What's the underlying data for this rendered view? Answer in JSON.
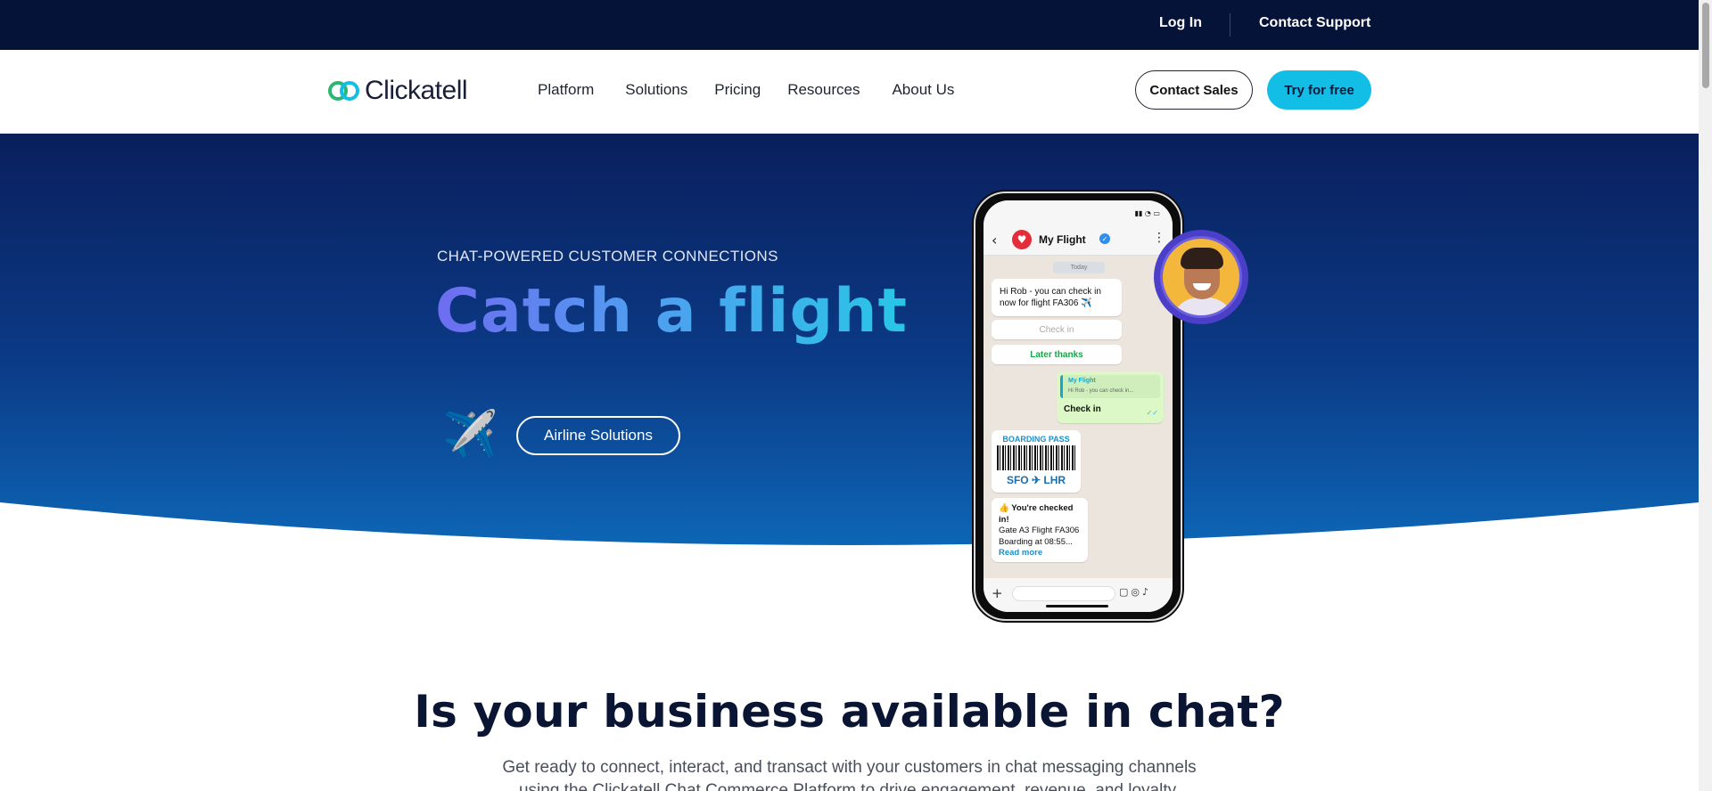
{
  "topbar": {
    "login": "Log In",
    "support": "Contact Support"
  },
  "brand": {
    "name": "Clickatell"
  },
  "nav": {
    "items": [
      "Platform",
      "Solutions",
      "Pricing",
      "Resources",
      "About Us"
    ],
    "contact_sales": "Contact Sales",
    "try_free": "Try for free"
  },
  "hero": {
    "eyebrow": "CHAT-POWERED CUSTOMER CONNECTIONS",
    "headline": "Catch a flight",
    "plane_emoji": "✈️",
    "cta": "Airline Solutions"
  },
  "phone": {
    "chat_name": "My Flight",
    "day": "Today",
    "message1": "Hi Rob - you can check in now for flight FA306 ✈️",
    "quick_reply1": "Check in",
    "quick_reply2": "Later thanks",
    "reply_quote_title": "My Flight",
    "reply_quote_text": "Hi Rob - you can check in...",
    "reply_text": "Check in",
    "boarding_title": "BOARDING PASS",
    "boarding_route": "SFO ✈ LHR",
    "checked_line1": "👍 You're checked in!",
    "checked_line2": "Gate A3  Flight FA306",
    "checked_line3": "Boarding at 08:55...",
    "checked_link": "Read more"
  },
  "section": {
    "title": "Is your business available in chat?",
    "body": "Get ready to connect, interact, and transact with your customers in chat messaging channels using the Clickatell Chat Commerce Platform to drive engagement, revenue, and loyalty."
  },
  "colors": {
    "topbar": "#061338",
    "hero_top": "#0a1f5c",
    "hero_bottom": "#0c5fb0",
    "accent": "#12bde6"
  }
}
